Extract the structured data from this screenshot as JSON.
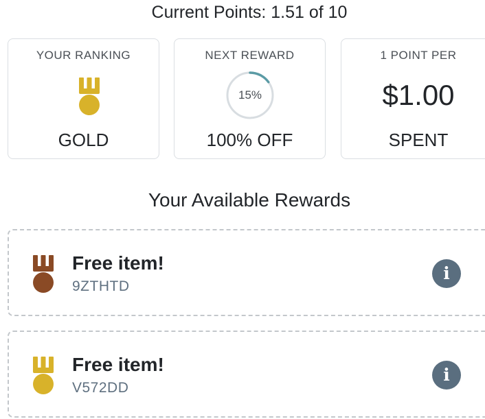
{
  "header": {
    "points_text": "Current Points: 1.51 of 10"
  },
  "cards": {
    "ranking": {
      "label": "YOUR RANKING",
      "value": "GOLD",
      "icon": "gold-medal-icon",
      "color": "#d8b22a"
    },
    "next_reward": {
      "label": "NEXT REWARD",
      "progress_text": "15%",
      "progress": 0.15,
      "value": "100% OFF",
      "ring_color": "#5b9ba5"
    },
    "rate": {
      "label": "1 POINT PER",
      "amount": "$1.00",
      "value": "SPENT"
    }
  },
  "rewards_section": {
    "title": "Your Available Rewards",
    "items": [
      {
        "title": "Free item!",
        "code": "9ZTHTD",
        "icon": "bronze-medal-icon",
        "color": "#8a4a25"
      },
      {
        "title": "Free item!",
        "code": "V572DD",
        "icon": "gold-medal-icon",
        "color": "#d8b22a"
      }
    ]
  }
}
